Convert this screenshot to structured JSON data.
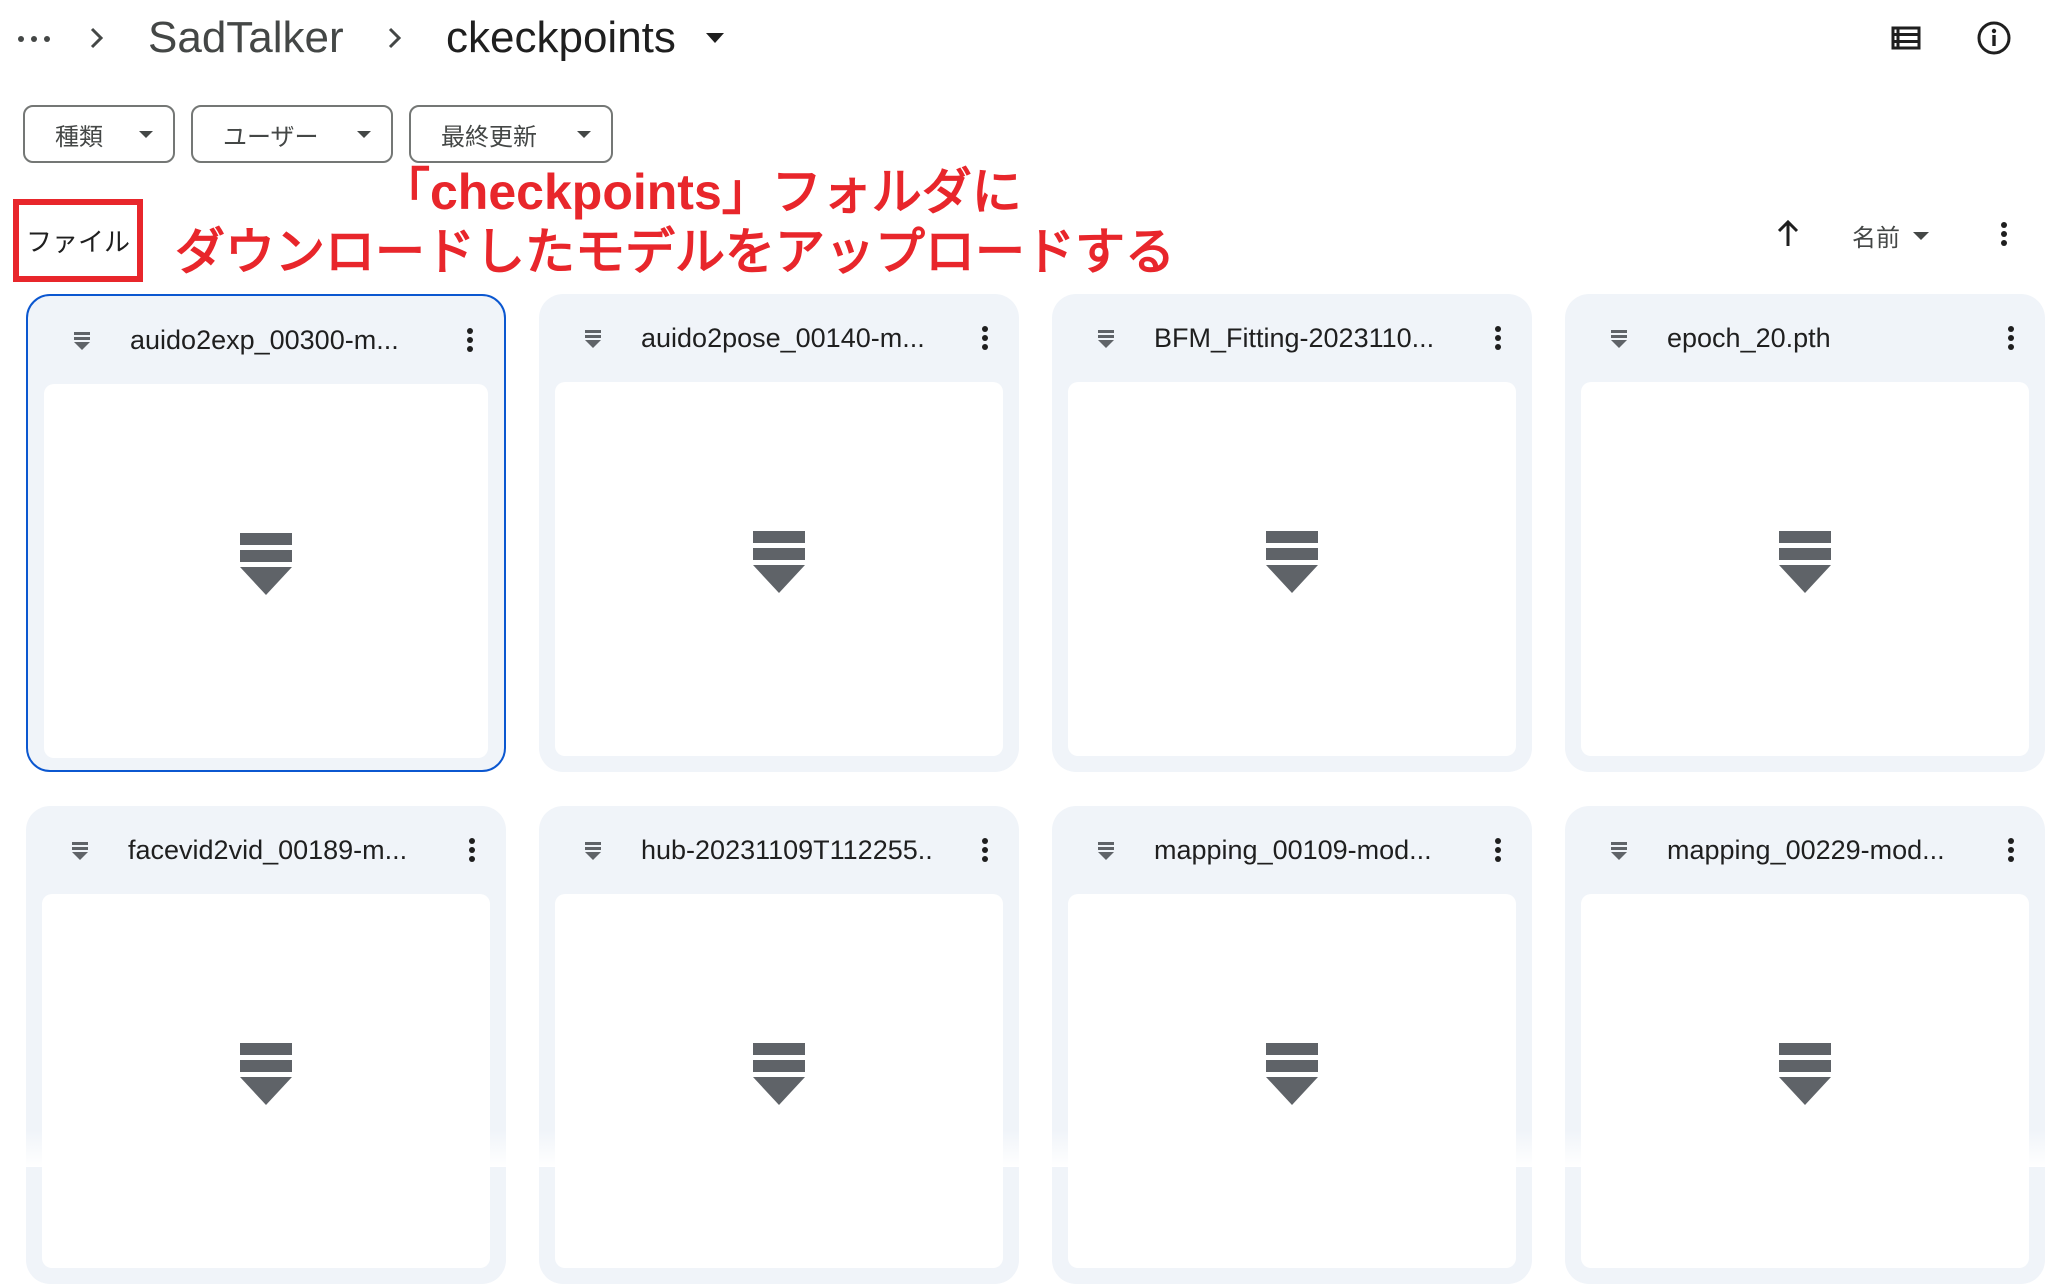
{
  "breadcrumb": {
    "more_icon": "more-horiz-icon",
    "parent": "SadTalker",
    "current": "ckeckpoints"
  },
  "toolbar_icons": [
    "list-view-icon",
    "info-icon"
  ],
  "filters": [
    {
      "label": "種類"
    },
    {
      "label": "ユーザー"
    },
    {
      "label": "最終更新"
    }
  ],
  "section": {
    "files_label": "ファイル"
  },
  "annotation": {
    "line1": "「checkpoints」フォルダに",
    "line2": "ダウンロードしたモデルをアップロードする",
    "color": "#e8262b"
  },
  "sort": {
    "direction_icon": "arrow-upward-icon",
    "label": "名前"
  },
  "files": [
    {
      "name": "auido2exp_00300-m...",
      "selected": true
    },
    {
      "name": "auido2pose_00140-m...",
      "selected": false
    },
    {
      "name": "BFM_Fitting-2023110...",
      "selected": false
    },
    {
      "name": "epoch_20.pth",
      "selected": false
    },
    {
      "name": "facevid2vid_00189-m...",
      "selected": false
    },
    {
      "name": "hub-20231109T112255...",
      "selected": false
    },
    {
      "name": "mapping_00109-mod...",
      "selected": false
    },
    {
      "name": "mapping_00229-mod...",
      "selected": false
    }
  ],
  "colors": {
    "card_bg": "#f0f4f9",
    "selected_border": "#0b57d0",
    "icon_gray": "#5f6368"
  }
}
